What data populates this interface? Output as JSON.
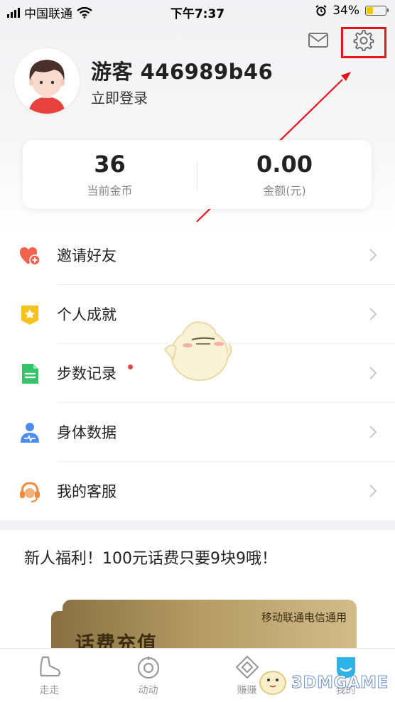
{
  "status_bar": {
    "carrier": "中国联通",
    "time": "下午7:37",
    "battery_percent": "34%",
    "battery_level": 0.34
  },
  "profile": {
    "user_name": "游客 446989b46",
    "login_link": "立即登录"
  },
  "stats": [
    {
      "value": "36",
      "label": "当前金币"
    },
    {
      "value": "0.00",
      "label": "金额(元)"
    }
  ],
  "menu": [
    {
      "label": "邀请好友",
      "icon": "heart-plus-icon"
    },
    {
      "label": "个人成就",
      "icon": "star-badge-icon"
    },
    {
      "label": "步数记录",
      "icon": "document-icon"
    },
    {
      "label": "身体数据",
      "icon": "person-pulse-icon"
    },
    {
      "label": "我的客服",
      "icon": "headset-icon"
    }
  ],
  "promo": {
    "title": "新人福利！100元话费只要9块9哦！",
    "card_tag": "移动联通电信通用",
    "card_title": "话费充值"
  },
  "tabs": [
    {
      "label": "走走",
      "icon": "shoe-icon"
    },
    {
      "label": "动动",
      "icon": "circle-ring-icon"
    },
    {
      "label": "赚赚",
      "icon": "diamond-icon"
    },
    {
      "label": "我的",
      "icon": "profile-tab-icon"
    }
  ],
  "watermark": {
    "text": "3DMGAME"
  },
  "colors": {
    "highlight": "#e8141b",
    "active_tab": "#2db3e8",
    "achievement_dot": "#e84a4a"
  }
}
